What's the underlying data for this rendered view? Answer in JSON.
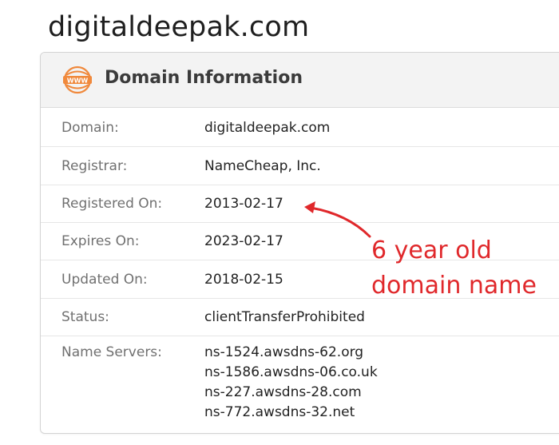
{
  "site_title": "digitaldeepak.com",
  "card": {
    "icon": "www-globe-icon",
    "title": "Domain Information",
    "rows": [
      {
        "label": "Domain:",
        "value": "digitaldeepak.com"
      },
      {
        "label": "Registrar:",
        "value": "NameCheap, Inc."
      },
      {
        "label": "Registered On:",
        "value": "2013-02-17"
      },
      {
        "label": "Expires On:",
        "value": "2023-02-17"
      },
      {
        "label": "Updated On:",
        "value": "2018-02-15"
      },
      {
        "label": "Status:",
        "value": "clientTransferProhibited"
      }
    ],
    "name_servers": {
      "label": "Name Servers:",
      "values": [
        "ns-1524.awsdns-62.org",
        "ns-1586.awsdns-06.co.uk",
        "ns-227.awsdns-28.com",
        "ns-772.awsdns-32.net"
      ]
    }
  },
  "annotation": {
    "line1": "6 year old",
    "line2": "domain name",
    "color": "#e0282b"
  },
  "colors": {
    "icon_accent": "#f0893c",
    "header_bg": "#f3f3f3"
  }
}
